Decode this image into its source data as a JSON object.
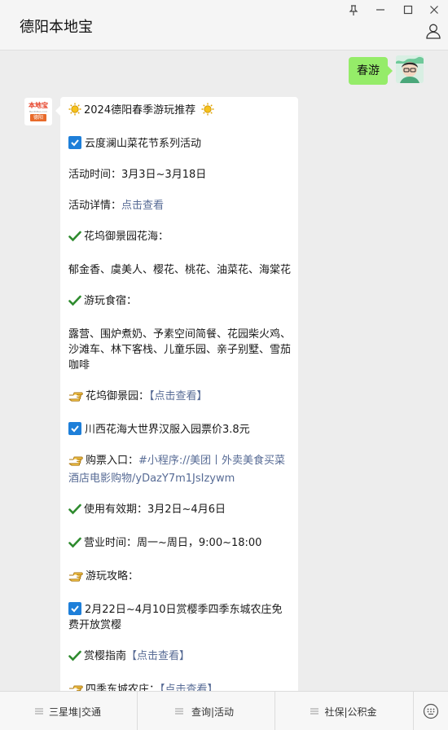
{
  "window": {
    "title": "德阳本地宝",
    "controls": [
      "pin-icon",
      "minimize-icon",
      "maximize-icon",
      "close-icon"
    ]
  },
  "chat": {
    "outgoing": {
      "text": "春游",
      "bubble_color": "#95ec69"
    },
    "bot_avatar": {
      "line1": "本地宝",
      "line2": "BenDiBao.com",
      "line3": "德阳"
    },
    "message": {
      "title": "2024德阳春季游玩推荐",
      "section1_title": "云度澜山菜花节系列活动",
      "time_line": "活动时间：3月3日~3月18日",
      "detail_label": "活动详情：",
      "detail_link": "点击查看",
      "garden_sea_label": "花坞御景园花海：",
      "garden_sea_text": "郁金香、虞美人、樱花、桃花、油菜花、海棠花",
      "food_label": "游玩食宿：",
      "food_text": "露营、围炉煮奶、予素空间简餐、花园柴火鸡、沙滩车、林下客栈、儿童乐园、亲子别墅、雪茄咖啡",
      "garden_link_label": "花坞御景园：",
      "garden_link": "【点击查看】",
      "section2_title": "川西花海大世界汉服入园票价3.8元",
      "ticket_label": "购票入口：",
      "ticket_link": "#小程序://美团丨外卖美食买菜酒店电影购物/yDazY7m1JsIzywm",
      "validity": "使用有效期：3月2日~4月6日",
      "hours": "营业时间：周一~周日，9:00~18:00",
      "guide_label": "游玩攻略：",
      "section3_title": "2月22日~4月10日赏樱季四季东城农庄免费开放赏樱",
      "sakura_label": "赏樱指南",
      "sakura_link": "【点击查看】",
      "farm_label": "四季东城农庄：",
      "farm_link": "【点击查看】"
    }
  },
  "menu": {
    "items": [
      "三星堆|交通",
      "查询|活动",
      "社保|公积金"
    ]
  },
  "colors": {
    "link": "#576b95",
    "check_box": "#1e7fd9",
    "check_mark": "#2e8b2e",
    "background": "#ededed"
  }
}
